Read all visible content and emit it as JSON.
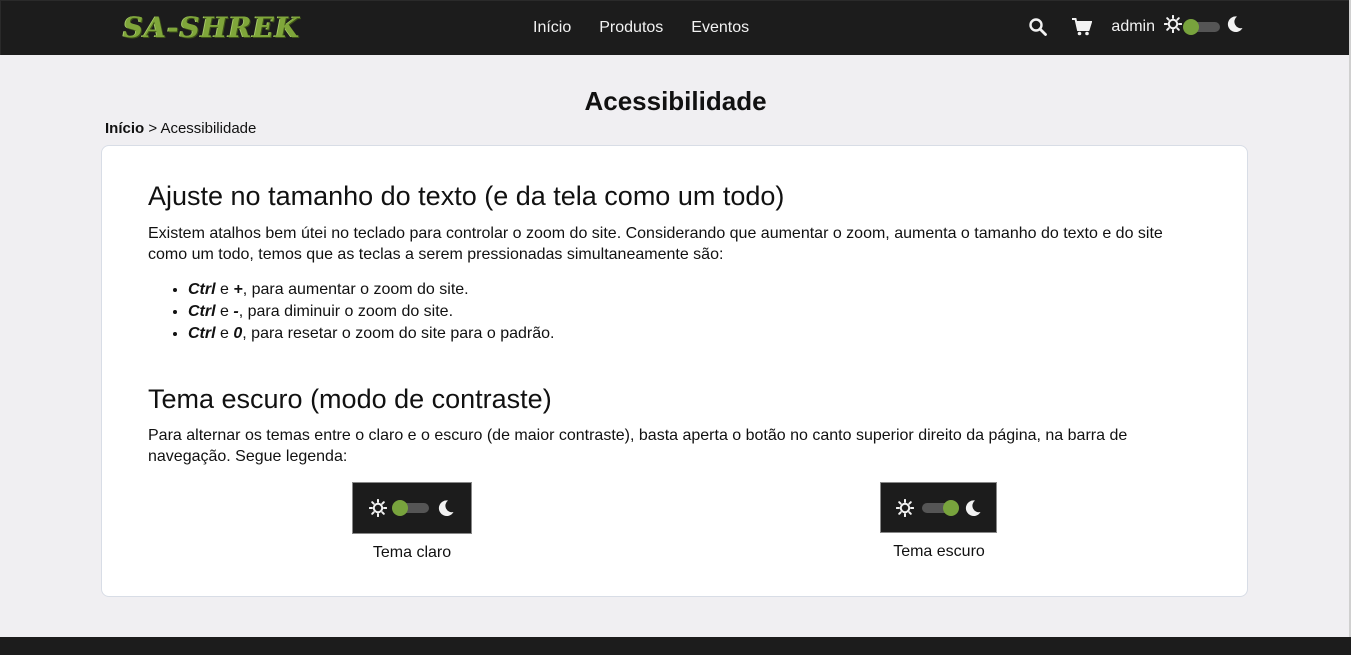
{
  "nav": {
    "logo": "SA-SHREK",
    "links": [
      "Início",
      "Produtos",
      "Eventos"
    ],
    "user": "admin",
    "icons": {
      "search": "search-icon",
      "cart": "cart-icon",
      "sun": "sun-icon",
      "moon": "moon-icon"
    },
    "theme_toggle_position": "light"
  },
  "page": {
    "title": "Acessibilidade",
    "breadcrumb": {
      "home": "Início",
      "separator": ">",
      "current": "Acessibilidade"
    }
  },
  "sections": {
    "zoom": {
      "heading": "Ajuste no tamanho do texto (e da tela como um todo)",
      "text": "Existem atalhos bem útei no teclado para controlar o zoom do site. Considerando que aumentar o zoom, aumenta o tamanho do texto e do site como um todo, temos que as teclas a serem pressionadas simultaneamente são:",
      "shortcuts": [
        {
          "key1": "Ctrl",
          "joiner": "e",
          "key2": "+",
          "desc": ", para aumentar o zoom do site."
        },
        {
          "key1": "Ctrl",
          "joiner": "e",
          "key2": "-",
          "desc": ", para diminuir o zoom do site."
        },
        {
          "key1": "Ctrl",
          "joiner": "e",
          "key2": "0",
          "desc": ", para resetar o zoom do site para o padrão."
        }
      ]
    },
    "theme": {
      "heading": "Tema escuro (modo de contraste)",
      "text": "Para alternar os temas entre o claro e o escuro (de maior contraste), basta aperta o botão no canto superior direito da página, na barra de navegação. Segue legenda:",
      "legend_light": "Tema claro",
      "legend_dark": "Tema escuro"
    }
  },
  "colors": {
    "navbar": "#1c1c1c",
    "accent_green": "#78a33d",
    "page_bg": "#f0eff2",
    "card_bg": "#ffffff"
  }
}
